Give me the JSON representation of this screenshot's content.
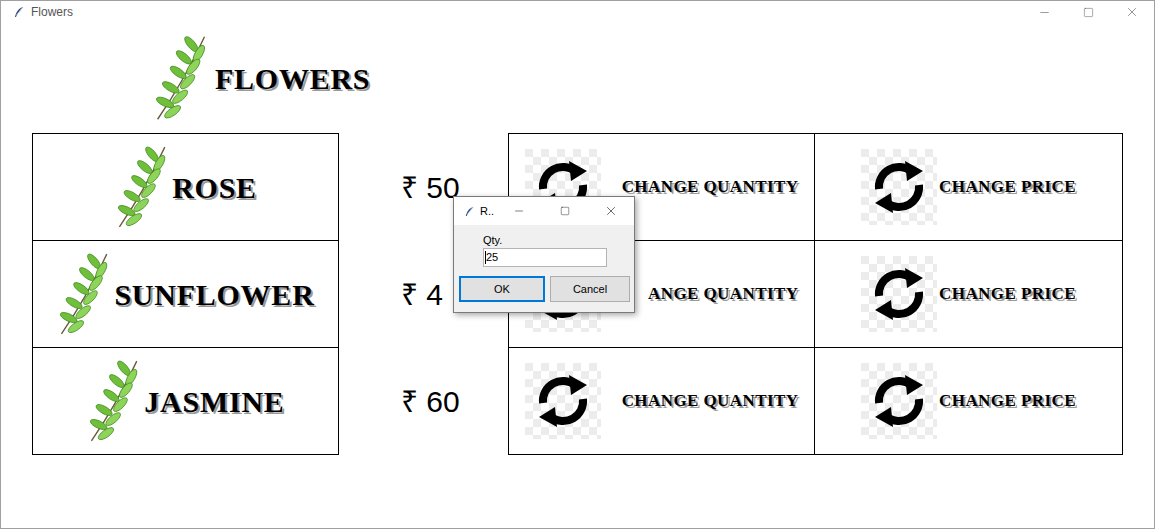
{
  "window": {
    "title": "Flowers"
  },
  "header": {
    "title": "FLOWERS"
  },
  "rows": [
    {
      "name": "ROSE",
      "price": "₹ 50",
      "quantity_button": "CHANGE QUANTITY",
      "price_button": "CHANGE PRICE"
    },
    {
      "name": "SUNFLOWER",
      "price": "₹ 4",
      "quantity_button": "ANGE QUANTITY",
      "price_button": "CHANGE PRICE"
    },
    {
      "name": "JASMINE",
      "price": "₹ 60",
      "quantity_button": "CHANGE QUANTITY",
      "price_button": "CHANGE PRICE"
    }
  ],
  "dialog": {
    "title": "R..",
    "label": "Qty.",
    "value": "25",
    "buttons": [
      {
        "label": "OK",
        "selected": true
      },
      {
        "label": "Cancel",
        "selected": false
      }
    ]
  }
}
